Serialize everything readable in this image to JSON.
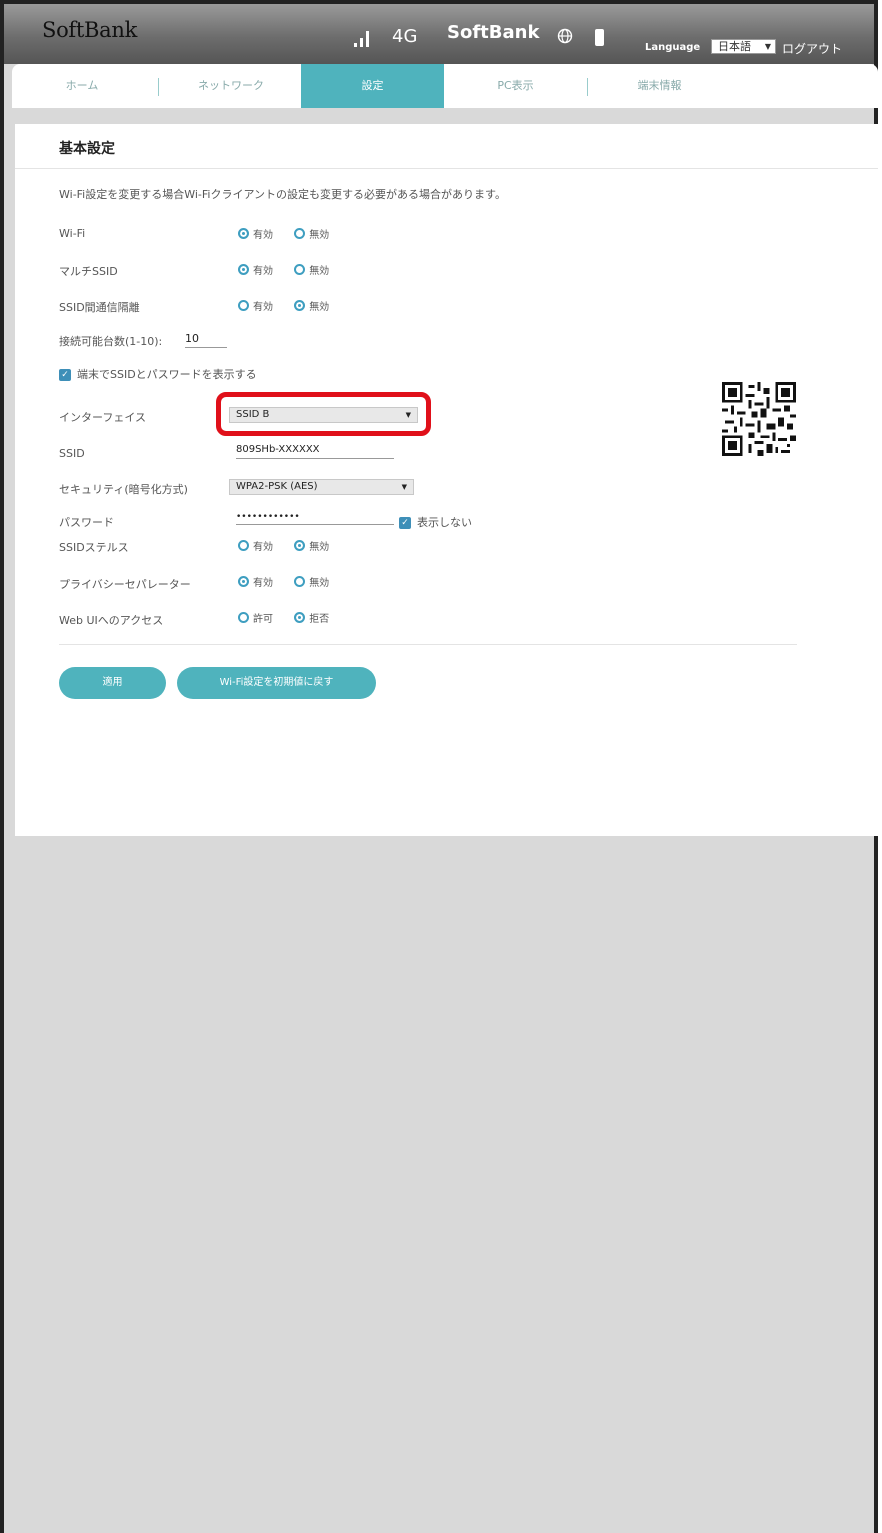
{
  "header": {
    "brand": "SoftBank",
    "network_type": "4G",
    "carrier": "SoftBank",
    "language_label": "Language",
    "language_value": "日本語",
    "logout": "ログアウト"
  },
  "tabs": [
    {
      "label": "ホーム",
      "active": false
    },
    {
      "label": "ネットワーク",
      "active": false
    },
    {
      "label": "設定",
      "active": true
    },
    {
      "label": "PC表示",
      "active": false
    },
    {
      "label": "端末情報",
      "active": false
    }
  ],
  "settings": {
    "title": "基本設定",
    "notice": "Wi-Fi設定を変更する場合Wi-Fiクライアントの設定も変更する必要がある場合があります。",
    "wifi": {
      "label": "Wi-Fi",
      "options": [
        "有効",
        "無効"
      ],
      "selected": "有効"
    },
    "multi_ssid": {
      "label": "マルチSSID",
      "options": [
        "有効",
        "無効"
      ],
      "selected": "有効"
    },
    "ssid_isolation": {
      "label": "SSID間通信隔離",
      "options": [
        "有効",
        "無効"
      ],
      "selected": "無効"
    },
    "max_clients": {
      "label": "接続可能台数(1-10):",
      "value": "10"
    },
    "show_on_device": {
      "label": "端末でSSIDとパスワードを表示する",
      "checked": true
    },
    "interface": {
      "label": "インターフェイス",
      "value": "SSID B"
    },
    "ssid": {
      "label": "SSID",
      "value": "809SHb-XXXXXX"
    },
    "security": {
      "label": "セキュリティ(暗号化方式)",
      "value": "WPA2-PSK (AES)"
    },
    "password": {
      "label": "パスワード",
      "value": "••••••••••••",
      "hide_label": "表示しない",
      "hide_checked": true
    },
    "ssid_stealth": {
      "label": "SSIDステルス",
      "options": [
        "有効",
        "無効"
      ],
      "selected": "無効"
    },
    "privacy_separator": {
      "label": "プライバシーセパレーター",
      "options": [
        "有効",
        "無効"
      ],
      "selected": "有効"
    },
    "web_ui_access": {
      "label": "Web UIへのアクセス",
      "options": [
        "許可",
        "拒否"
      ],
      "selected": "拒否"
    },
    "apply_button": "適用",
    "reset_button": "Wi-Fi設定を初期値に戻す"
  },
  "colors": {
    "accent": "#4fb3bd",
    "highlight": "#e0101a",
    "radio": "#3e9ec0"
  }
}
